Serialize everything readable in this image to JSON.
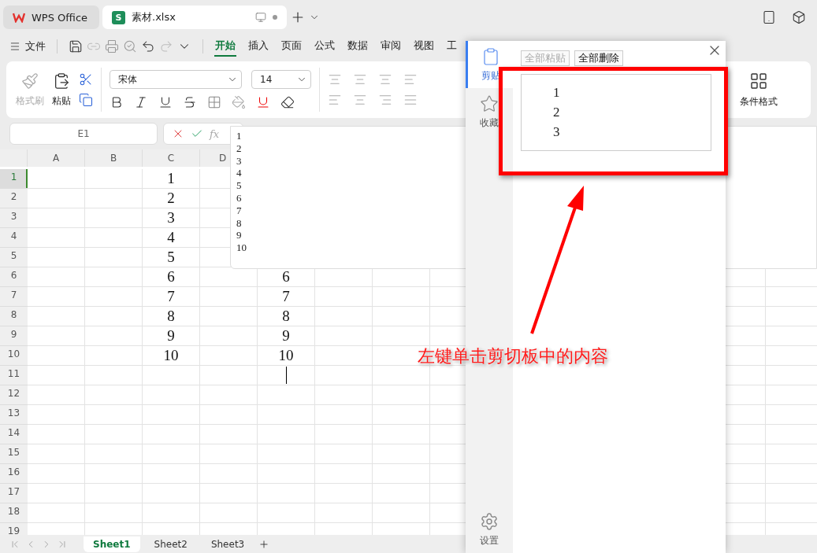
{
  "app_tabs": [
    {
      "label": "WPS Office",
      "kind": "home",
      "selected": false
    },
    {
      "label": "素材.xlsx",
      "kind": "sheet",
      "icon_text": "S",
      "selected": true
    }
  ],
  "menu": {
    "file": "文件",
    "tabs": [
      {
        "label": "开始",
        "selected": true
      },
      {
        "label": "插入",
        "selected": false
      },
      {
        "label": "页面",
        "selected": false
      },
      {
        "label": "公式",
        "selected": false
      },
      {
        "label": "数据",
        "selected": false
      },
      {
        "label": "审阅",
        "selected": false
      },
      {
        "label": "视图",
        "selected": false
      },
      {
        "label": "工",
        "selected": false
      }
    ]
  },
  "ribbon": {
    "format_painter": "格式刷",
    "paste": "粘贴",
    "font": "宋体",
    "size": "14",
    "conditional_format": "条件格式"
  },
  "name_box": "E1",
  "fx_label": "fx",
  "edit_popup": {
    "lines": [
      "1",
      "2",
      "3",
      "4",
      "5",
      "6",
      "7",
      "8",
      "9",
      "10"
    ]
  },
  "columns": [
    "A",
    "B",
    "C",
    "D"
  ],
  "rows": [
    {
      "label": "1",
      "selected": true,
      "column_c": "1"
    },
    {
      "label": "2",
      "selected": false,
      "column_c": "2"
    },
    {
      "label": "3",
      "selected": false,
      "column_c": "3"
    },
    {
      "label": "4",
      "selected": false,
      "column_c": "4"
    },
    {
      "label": "5",
      "selected": false,
      "column_c": "5"
    },
    {
      "label": "6",
      "selected": false,
      "column_c": "6",
      "column_e": "6"
    },
    {
      "label": "7",
      "selected": false,
      "column_c": "7",
      "column_e": "7"
    },
    {
      "label": "8",
      "selected": false,
      "column_c": "8",
      "column_e": "8"
    },
    {
      "label": "9",
      "selected": false,
      "column_c": "9",
      "column_e": "9"
    },
    {
      "label": "10",
      "selected": false,
      "column_c": "10",
      "column_e": "10"
    },
    {
      "label": "11",
      "selected": false,
      "cursor": true
    },
    {
      "label": "12",
      "selected": false
    },
    {
      "label": "13",
      "selected": false
    },
    {
      "label": "14",
      "selected": false
    },
    {
      "label": "15",
      "selected": false
    },
    {
      "label": "16",
      "selected": false
    },
    {
      "label": "17",
      "selected": false
    },
    {
      "label": "18",
      "selected": false
    },
    {
      "label": "19",
      "selected": false
    }
  ],
  "sheet_tabs": [
    {
      "label": "Sheet1",
      "selected": true
    },
    {
      "label": "Sheet2",
      "selected": false
    },
    {
      "label": "Sheet3",
      "selected": false
    }
  ],
  "clipboard": {
    "nav": [
      {
        "label": "剪贴",
        "selected": true
      },
      {
        "label": "收藏",
        "selected": false
      }
    ],
    "settings": "设置",
    "buttons": [
      {
        "label": "全部粘贴",
        "disabled": true
      },
      {
        "label": "全部删除",
        "disabled": false
      }
    ],
    "items": [
      {
        "lines": [
          "1",
          "2",
          "3"
        ]
      }
    ]
  },
  "annotation": {
    "text": "左键单击剪切板中的内容"
  }
}
